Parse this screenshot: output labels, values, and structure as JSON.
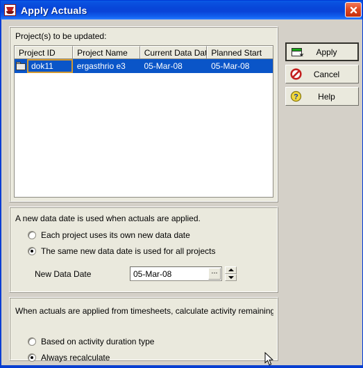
{
  "window": {
    "title": "Apply Actuals",
    "title_icon": "app-emblem-icon",
    "close_label": "✕",
    "accent_titlebar": "#0a44d8",
    "face_color": "#d4d0c8",
    "panel_color": "#eae9dd",
    "selection_color": "#0a55c8",
    "focus_cell_color": "#d39a31"
  },
  "list_panel": {
    "label": "Project(s) to be updated:",
    "columns": [
      "Project ID",
      "Project Name",
      "Current Data Date",
      "Planned Start"
    ],
    "rows": [
      {
        "icon": "folder-icon",
        "project_id": "dok11",
        "project_name": "ergasthrio e3",
        "current_data_date": "05-Mar-08",
        "planned_start": "05-Mar-08",
        "selected": true,
        "focused_cell": "project_id"
      }
    ]
  },
  "date_panel": {
    "description": "A new data date is used when actuals are applied.",
    "options": [
      {
        "label": "Each project uses its own new data date",
        "selected": false
      },
      {
        "label": "The same new data date is used for all projects",
        "selected": true
      }
    ],
    "field_label": "New Data Date",
    "field_value": "05-Mar-08",
    "browse_label": "...",
    "spinner_up": "spinner-up-icon",
    "spinner_down": "spinner-down-icon"
  },
  "calc_panel": {
    "description": "When actuals are applied from timesheets, calculate activity remaining duratio",
    "options": [
      {
        "label": "Based on activity duration type",
        "selected": false
      },
      {
        "label": "Always recalculate",
        "selected": true
      }
    ]
  },
  "buttons": [
    {
      "label": "Apply",
      "icon": "apply-sheet-icon",
      "default": true
    },
    {
      "label": "Cancel",
      "icon": "no-entry-icon",
      "default": false
    },
    {
      "label": "Help",
      "icon": "question-mark-icon",
      "default": false
    }
  ]
}
